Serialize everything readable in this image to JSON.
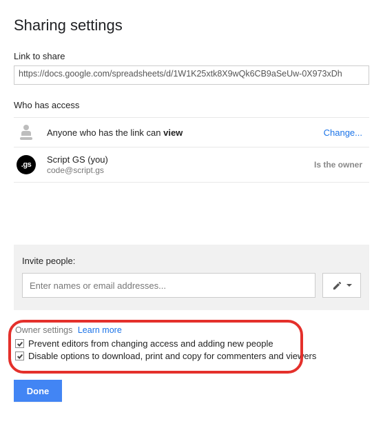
{
  "title": "Sharing settings",
  "link_section": {
    "label": "Link to share",
    "url": "https://docs.google.com/spreadsheets/d/1W1K25xtk8X9wQk6CB9aSeUw-0X973xDh"
  },
  "access_section": {
    "label": "Who has access",
    "rows": [
      {
        "icon": "link-person",
        "text_prefix": "Anyone who has the link can ",
        "text_bold": "view",
        "action": "Change..."
      },
      {
        "icon": "avatar-gs",
        "avatar_text": ".gs",
        "name": "Script GS (you)",
        "sub": "code@script.gs",
        "owner_tag": "Is the owner"
      }
    ]
  },
  "invite": {
    "label": "Invite people:",
    "placeholder": "Enter names or email addresses...",
    "perm_icon": "pencil"
  },
  "owner_settings": {
    "heading": "Owner settings",
    "learn_more": "Learn more",
    "options": [
      {
        "checked": true,
        "label": "Prevent editors from changing access and adding new people"
      },
      {
        "checked": true,
        "label": "Disable options to download, print and copy for commenters and viewers"
      }
    ]
  },
  "done_label": "Done"
}
